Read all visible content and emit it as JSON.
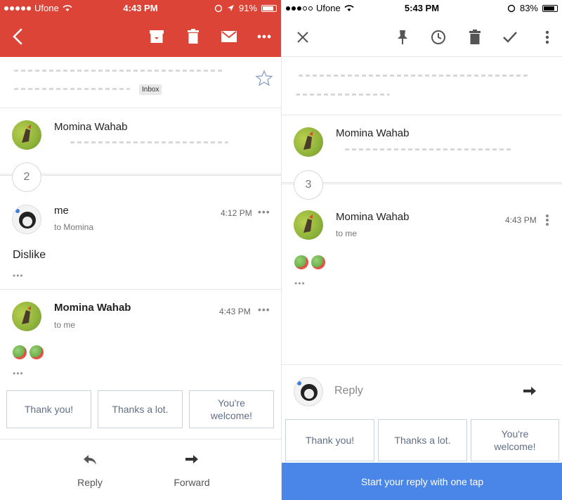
{
  "left": {
    "status": {
      "carrier": "Ufone",
      "time": "4:43 PM",
      "battery": "91%"
    },
    "header": {
      "accent": "#dc4437"
    },
    "subject": {
      "label_chip": "Inbox"
    },
    "thread_first": {
      "sender": "Momina Wahab"
    },
    "collapsed_count": "2",
    "message_me": {
      "sender": "me",
      "to": "to Momina",
      "time": "4:12 PM",
      "body": "Dislike"
    },
    "message_momina": {
      "sender": "Momina Wahab",
      "to": "to me",
      "time": "4:43 PM"
    },
    "smart_replies": [
      "Thank you!",
      "Thanks a lot.",
      "You're welcome!"
    ],
    "footer": {
      "reply": "Reply",
      "forward": "Forward"
    }
  },
  "right": {
    "status": {
      "carrier": "Ufone",
      "time": "5:43 PM",
      "battery": "83%"
    },
    "thread_first": {
      "sender": "Momina Wahab"
    },
    "collapsed_count": "3",
    "message_momina": {
      "sender": "Momina Wahab",
      "to": "to me",
      "time": "4:43 PM"
    },
    "reply_placeholder": "Reply",
    "smart_replies": [
      "Thank you!",
      "Thanks a lot.",
      "You're welcome!"
    ],
    "cta": "Start your reply with one tap",
    "cta_color": "#4a86e8"
  }
}
